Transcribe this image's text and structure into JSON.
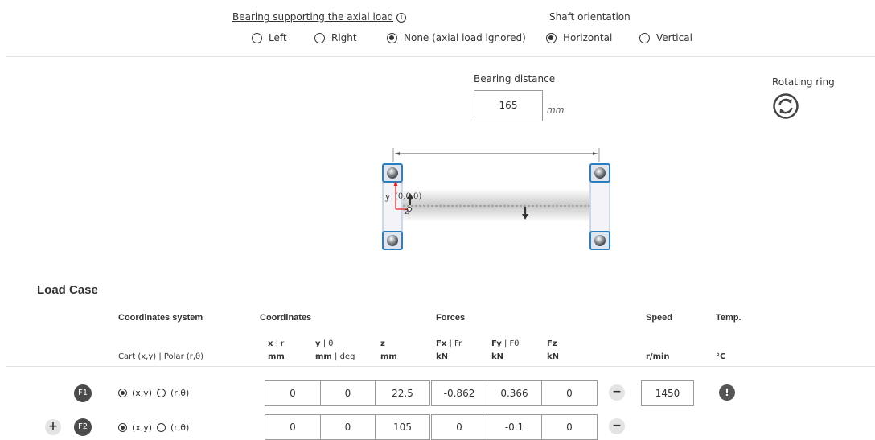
{
  "axial": {
    "label": "Bearing supporting the axial load",
    "info": "i",
    "options": [
      "Left",
      "Right",
      "None (axial load ignored)"
    ],
    "selected": 2
  },
  "orientation": {
    "label": "Shaft orientation",
    "options": [
      "Horizontal",
      "Vertical"
    ],
    "selected": 0
  },
  "bearing_distance": {
    "label": "Bearing distance",
    "value": "165",
    "unit": "mm"
  },
  "rotating_ring": {
    "label": "Rotating ring",
    "icon": "rotate-icon"
  },
  "diagram": {
    "y": "y",
    "z": "z",
    "origin": "(0,0,0)"
  },
  "load_case": {
    "title": "Load Case",
    "headers": {
      "coord_system": "Coordinates system",
      "coordinates": "Coordinates",
      "forces": "Forces",
      "speed": "Speed",
      "temp": "Temp."
    },
    "subheaders": {
      "coord_system": "Cart (x,y) | Polar (r,θ)",
      "x_top_bold": "x",
      "x_top_rest": " | r",
      "x_unit": "mm",
      "y_top_bold": "y",
      "y_top_rest": " | θ",
      "y_unit_bold": "mm",
      "y_unit_rest": " | deg",
      "z_top": "z",
      "z_unit": "mm",
      "fx_top_bold": "Fx",
      "fx_top_rest": " | Fr",
      "fx_unit": "kN",
      "fy_top_bold": "Fy",
      "fy_top_rest": " | Fθ",
      "fy_unit": "kN",
      "fz_top": "Fz",
      "fz_unit": "kN",
      "speed_unit": "r/min",
      "temp_unit": "°C"
    },
    "cart_label": "(x,y)",
    "polar_label": "(r,θ)",
    "rows": [
      {
        "name": "F1",
        "x": "0",
        "y": "0",
        "z": "22.5",
        "fx": "-0.862",
        "fy": "0.366",
        "fz": "0",
        "speed": "1450",
        "temp_icon": "!"
      },
      {
        "name": "F2",
        "x": "0",
        "y": "0",
        "z": "105",
        "fx": "0",
        "fy": "-0.1",
        "fz": "0"
      }
    ],
    "add_symbol": "+",
    "remove_symbol": "−"
  }
}
